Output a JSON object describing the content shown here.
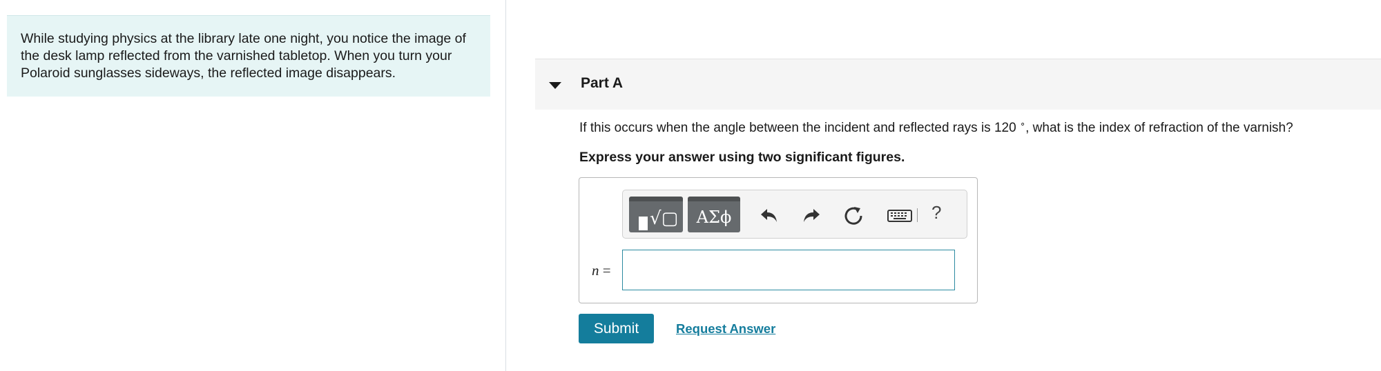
{
  "problem": {
    "text": "While studying physics at the library late one night, you notice the image of the desk lamp reflected from the varnished tabletop. When you turn your Polaroid sunglasses sideways, the reflected image disappears."
  },
  "part": {
    "title": "Part A",
    "question_prefix": "If this occurs when the angle between the incident and reflected rays is 120 ",
    "question_degree": "∘",
    "question_suffix": ", what is the index of refraction of the varnish?",
    "instruction": "Express your answer using two significant figures."
  },
  "toolbar": {
    "templates_icon": "templates-icon",
    "symbols_label": "ΑΣϕ",
    "undo_icon": "undo-icon",
    "redo_icon": "redo-icon",
    "reset_icon": "reset-icon",
    "keyboard_icon": "keyboard-icon",
    "help_label": "?"
  },
  "answer": {
    "variable": "n",
    "equals": " =",
    "value": ""
  },
  "actions": {
    "submit_label": "Submit",
    "request_answer_label": "Request Answer"
  },
  "colors": {
    "problem_bg": "#e6f5f5",
    "accent": "#147d9c",
    "link": "#157d9d"
  }
}
